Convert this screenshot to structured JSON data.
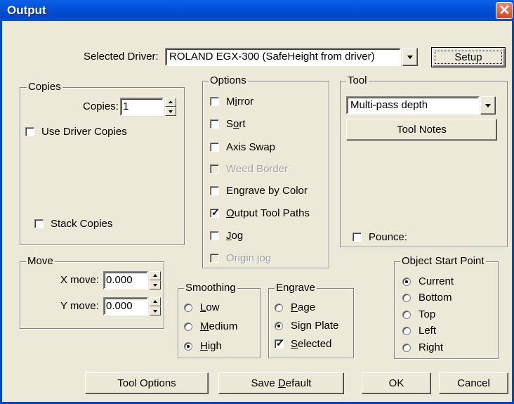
{
  "window": {
    "title": "Output"
  },
  "driver": {
    "label": "Selected Driver:",
    "value": "ROLAND EGX-300 (SafeHeight from driver)",
    "setup_label": "Setup"
  },
  "copies": {
    "legend": "Copies",
    "count_label": "Copies:",
    "count_value": "1",
    "use_driver_copies": "Use Driver Copies",
    "stack_copies": "Stack Copies"
  },
  "options": {
    "legend": "Options",
    "items": [
      {
        "pre": "M",
        "ul": "i",
        "post": "rror",
        "checked": false,
        "disabled": false
      },
      {
        "pre": "S",
        "ul": "o",
        "post": "rt",
        "checked": false,
        "disabled": false
      },
      {
        "pre": "",
        "ul": "",
        "post": "Axis Swap",
        "checked": false,
        "disabled": false
      },
      {
        "pre": "",
        "ul": "",
        "post": "Weed Border",
        "checked": false,
        "disabled": true
      },
      {
        "pre": "",
        "ul": "",
        "post": "Engrave by Color",
        "checked": false,
        "disabled": false
      },
      {
        "pre": "",
        "ul": "O",
        "post": "utput Tool Paths",
        "checked": true,
        "disabled": false
      },
      {
        "pre": "",
        "ul": "J",
        "post": "og",
        "checked": false,
        "disabled": false
      },
      {
        "pre": "",
        "ul": "",
        "post": "Origin jog",
        "checked": false,
        "disabled": true
      }
    ]
  },
  "tool": {
    "legend": "Tool",
    "select_value": "Multi-pass depth",
    "notes_label": "Tool Notes",
    "pounce_label": "Pounce:"
  },
  "move": {
    "legend": "Move",
    "x_label": "X move:",
    "x_value": "0.000",
    "y_label": "Y move:",
    "y_value": "0.000"
  },
  "smoothing": {
    "legend": "Smoothing",
    "items": [
      {
        "pre": "",
        "ul": "L",
        "post": "ow",
        "selected": false
      },
      {
        "pre": "",
        "ul": "M",
        "post": "edium",
        "selected": false
      },
      {
        "pre": "",
        "ul": "H",
        "post": "igh",
        "selected": true
      }
    ]
  },
  "engrave": {
    "legend": "Engrave",
    "page": {
      "pre": "",
      "ul": "P",
      "post": "age",
      "selected": false
    },
    "sign_plate": {
      "label": "Sign Plate",
      "selected": true
    },
    "selected": {
      "pre": "",
      "ul": "S",
      "post": "elected",
      "checked": true
    }
  },
  "start_point": {
    "legend": "Object Start Point",
    "items": [
      {
        "label": "Current",
        "selected": true
      },
      {
        "label": "Bottom",
        "selected": false
      },
      {
        "label": "Top",
        "selected": false
      },
      {
        "label": "Left",
        "selected": false
      },
      {
        "label": "Right",
        "selected": false
      }
    ]
  },
  "buttons": {
    "tool_options": "Tool Options",
    "save_default_pre": "Save ",
    "save_default_ul": "D",
    "save_default_post": "efault",
    "ok": "OK",
    "cancel": "Cancel"
  }
}
